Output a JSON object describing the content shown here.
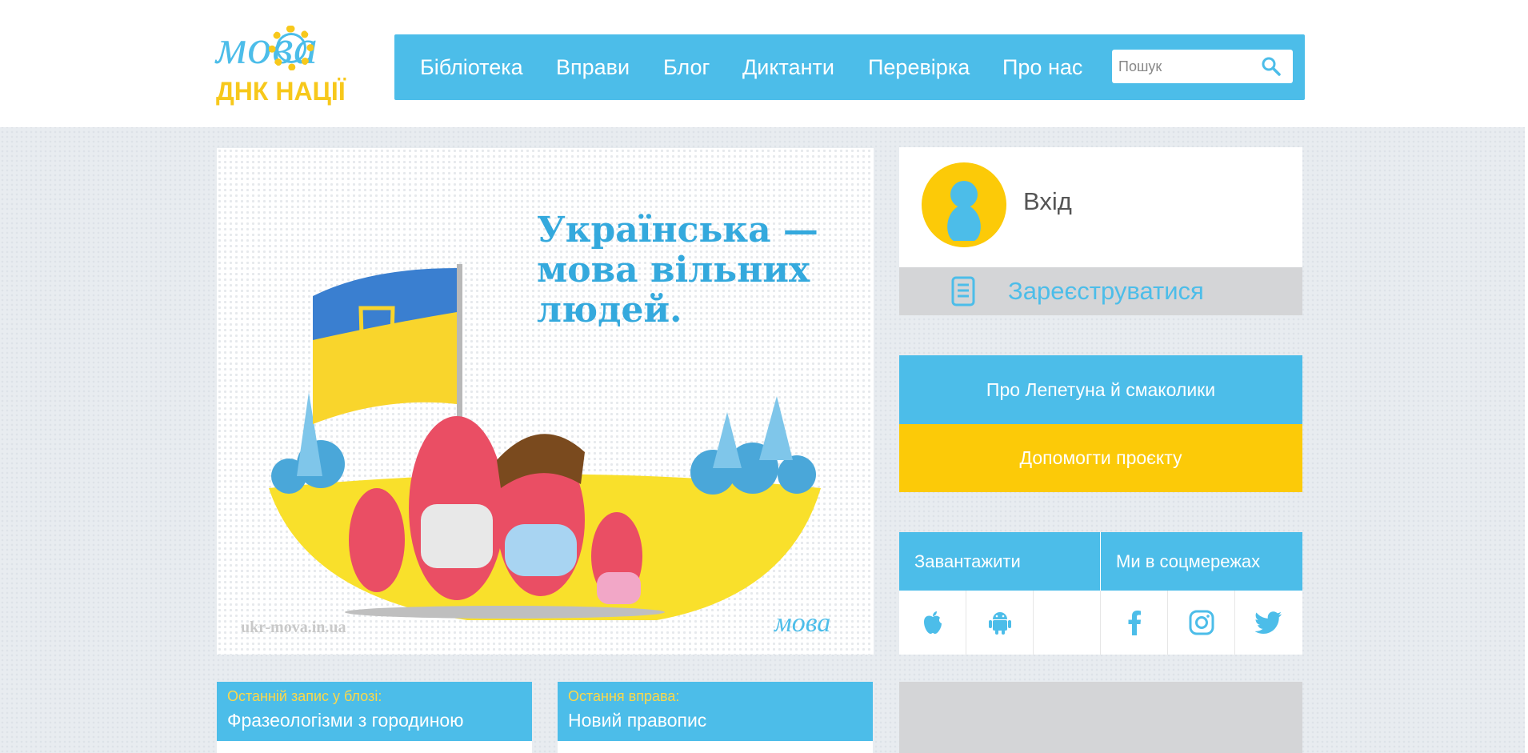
{
  "logo": {
    "line1": "мова",
    "line2": "ДНК НАЦІЇ"
  },
  "nav": {
    "items": [
      "Бібліотека",
      "Вправи",
      "Блог",
      "Диктанти",
      "Перевірка",
      "Про нас"
    ],
    "search_placeholder": "Пошук"
  },
  "hero": {
    "slogan": "Українська —\nмова вільних\nлюдей.",
    "watermark": "ukr-mova.in.ua",
    "mini_logo": "мова"
  },
  "login": {
    "signin_label": "Вхід",
    "register_label": "Зареєструватися"
  },
  "actions": {
    "about_label": "Про Лепетуна й смаколики",
    "help_label": "Допомогти проєкту"
  },
  "social": {
    "download_label": "Завантажити",
    "social_label": "Ми в соцмережах",
    "download_icons": [
      "apple-icon",
      "android-icon"
    ],
    "social_icons": [
      "facebook-icon",
      "instagram-icon",
      "twitter-icon"
    ]
  },
  "cards": [
    {
      "kicker": "Останній запис у блозі:",
      "title": "Фразеологізми з городиною"
    },
    {
      "kicker": "Остання вправа:",
      "title": "Новий правопис"
    }
  ],
  "colors": {
    "brand_blue": "#4cbde9",
    "brand_yellow": "#fcca08",
    "gray": "#d4d5d7"
  }
}
